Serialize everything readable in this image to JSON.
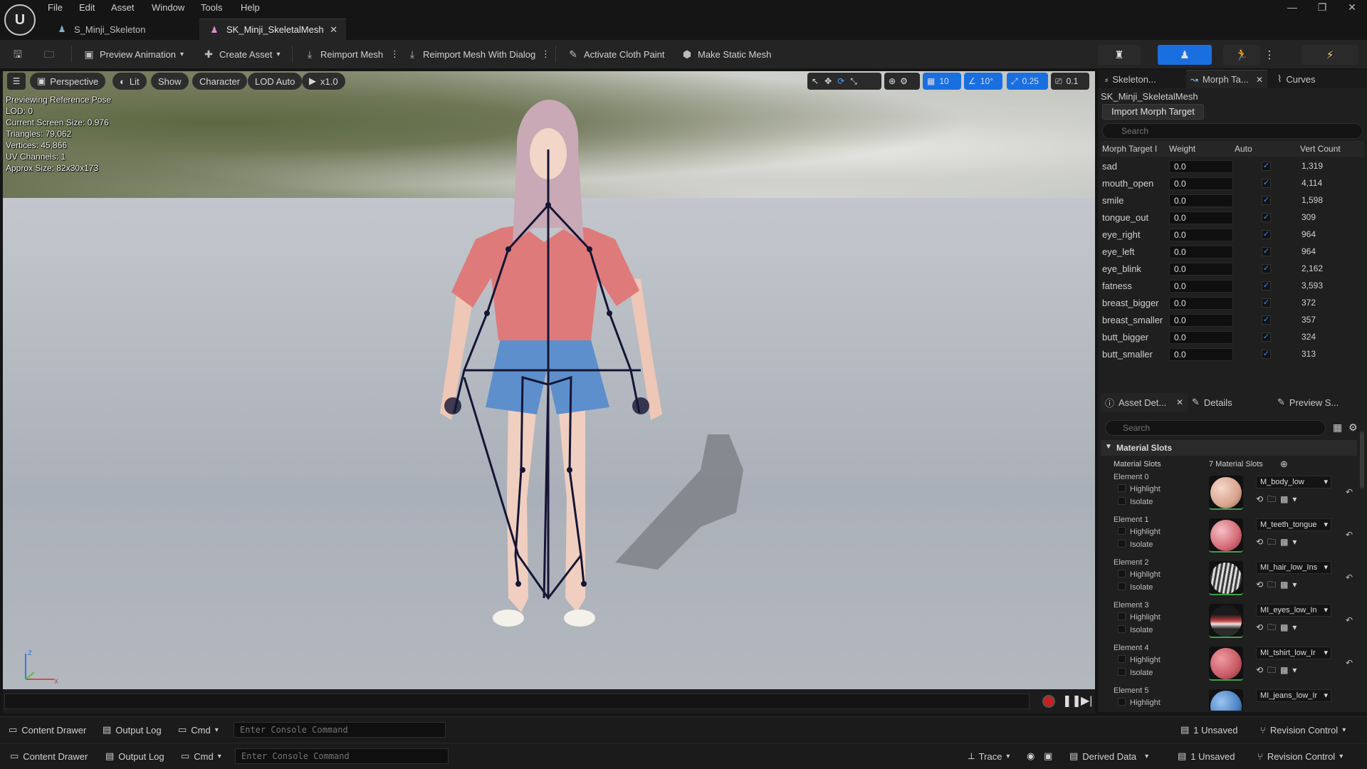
{
  "app": {
    "logo_text": "U"
  },
  "menu": [
    "File",
    "Edit",
    "Asset",
    "Window",
    "Tools",
    "Help"
  ],
  "tabs": [
    {
      "label": "S_Minji_Skeleton"
    },
    {
      "label": "SK_Minji_SkeletalMesh"
    }
  ],
  "toolbar": {
    "preview_animation": "Preview Animation",
    "create_asset": "Create Asset",
    "reimport_mesh": "Reimport Mesh",
    "reimport_dialog": "Reimport Mesh With Dialog",
    "cloth_paint": "Activate Cloth Paint",
    "static_mesh": "Make Static Mesh"
  },
  "viewport": {
    "perspective": "Perspective",
    "lit": "Lit",
    "show": "Show",
    "character": "Character",
    "lod": "LOD Auto",
    "speed": "x1.0",
    "grid_snap": "10",
    "rot_snap": "10°",
    "scale_snap": "0.25",
    "cam_speed": "0.1",
    "stats": [
      "Previewing Reference Pose",
      "LOD: 0",
      "Current Screen Size: 0.976",
      "Triangles: 79,062",
      "Vertices: 45,866",
      "UV Channels: 1",
      "Approx Size: 82x30x173"
    ],
    "axis_z": "z",
    "axis_x": "x"
  },
  "right_tabs": {
    "skeleton": "Skeleton...",
    "morph": "Morph Ta...",
    "curves": "Curves"
  },
  "morph": {
    "mesh_name": "SK_Minji_SkeletalMesh",
    "import_label": "Import Morph Target",
    "search_placeholder": "Search",
    "headers": {
      "name": "Morph Target I",
      "weight": "Weight",
      "auto": "Auto",
      "count": "Vert Count"
    },
    "rows": [
      {
        "name": "sad",
        "weight": "0.0",
        "count": "1,319"
      },
      {
        "name": "mouth_open",
        "weight": "0.0",
        "count": "4,114"
      },
      {
        "name": "smile",
        "weight": "0.0",
        "count": "1,598"
      },
      {
        "name": "tongue_out",
        "weight": "0.0",
        "count": "309"
      },
      {
        "name": "eye_right",
        "weight": "0.0",
        "count": "964"
      },
      {
        "name": "eye_left",
        "weight": "0.0",
        "count": "964"
      },
      {
        "name": "eye_blink",
        "weight": "0.0",
        "count": "2,162"
      },
      {
        "name": "fatness",
        "weight": "0.0",
        "count": "3,593"
      },
      {
        "name": "breast_bigger",
        "weight": "0.0",
        "count": "372"
      },
      {
        "name": "breast_smaller",
        "weight": "0.0",
        "count": "357"
      },
      {
        "name": "butt_bigger",
        "weight": "0.0",
        "count": "324"
      },
      {
        "name": "butt_smaller",
        "weight": "0.0",
        "count": "313"
      }
    ]
  },
  "asset_tabs": {
    "asset_details": "Asset Det...",
    "details": "Details",
    "preview": "Preview S..."
  },
  "asset": {
    "search_placeholder": "Search",
    "section": "Material Slots",
    "slots_label": "Material Slots",
    "slots_count": "7 Material Slots",
    "highlight": "Highlight",
    "isolate": "Isolate",
    "elements": [
      {
        "label": "Element 0",
        "material": "M_body_low",
        "color": "#e8b6a3"
      },
      {
        "label": "Element 1",
        "material": "M_teeth_tongue",
        "color": "#e0848c"
      },
      {
        "label": "Element 2",
        "material": "MI_hair_low_Ins",
        "color": "#9a9a9a"
      },
      {
        "label": "Element 3",
        "material": "MI_eyes_low_In",
        "color": "#6b2a2a"
      },
      {
        "label": "Element 4",
        "material": "MI_tshirt_low_Ir",
        "color": "#d4707a"
      },
      {
        "label": "Element 5",
        "material": "MI_jeans_low_Ir",
        "color": "#4f86c8"
      }
    ]
  },
  "bottom": {
    "content_drawer": "Content Drawer",
    "output_log": "Output Log",
    "cmd": "Cmd",
    "console_placeholder": "Enter Console Command",
    "trace": "Trace",
    "derived_data": "Derived Data",
    "unsaved": "1 Unsaved",
    "revision": "Revision Control"
  },
  "colors": {
    "accent": "#1a6fe0",
    "check": "#3a8cff",
    "skeleton_line": "#151535"
  }
}
